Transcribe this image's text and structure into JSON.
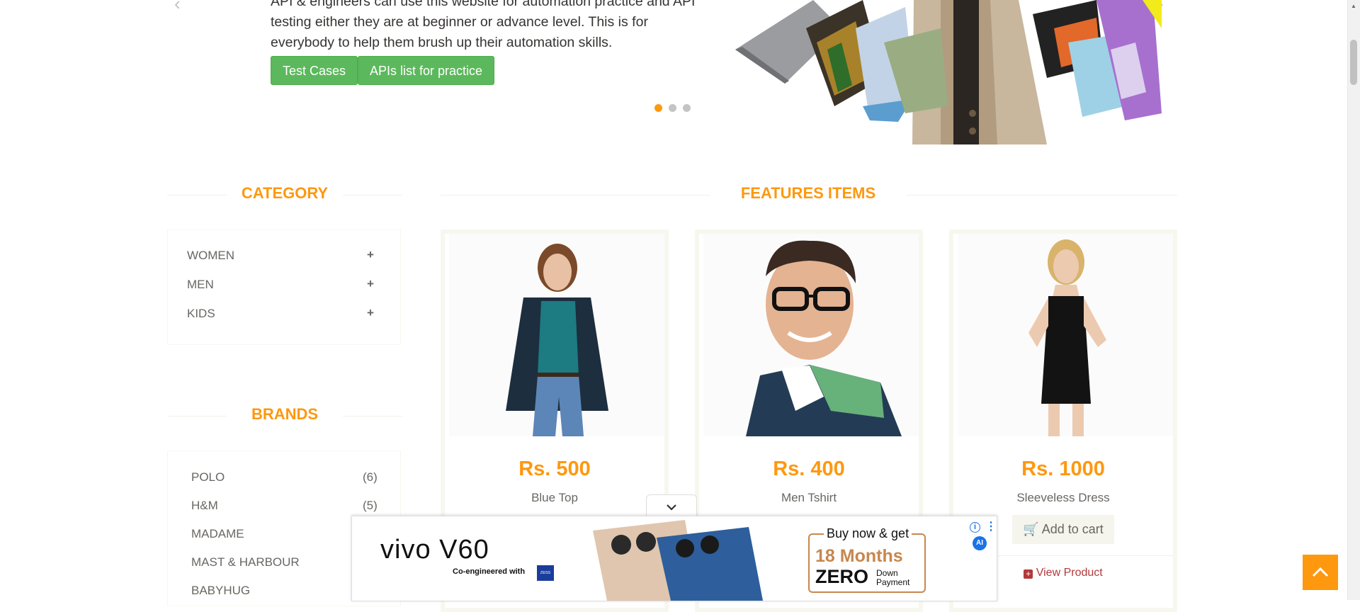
{
  "hero": {
    "text": "API & engineers can use this website for automation practice and API testing either they are at beginner or advance level. This is for everybody to help them brush up their automation skills.",
    "buttons": [
      "Test Cases",
      "APIs list for practice"
    ],
    "slides": 3,
    "active_slide": 1
  },
  "sidebar": {
    "category_title": "CATEGORY",
    "categories": [
      "WOMEN",
      "MEN",
      "KIDS"
    ],
    "brands_title": "BRANDS",
    "brands": [
      {
        "name": "POLO",
        "count": "(6)"
      },
      {
        "name": "H&M",
        "count": "(5)"
      },
      {
        "name": "MADAME",
        "count": ""
      },
      {
        "name": "MAST & HARBOUR",
        "count": ""
      },
      {
        "name": "BABYHUG",
        "count": ""
      }
    ]
  },
  "features": {
    "title": "FEATURES ITEMS",
    "products": [
      {
        "price": "Rs. 500",
        "name": "Blue Top"
      },
      {
        "price": "Rs. 400",
        "name": "Men Tshirt"
      },
      {
        "price": "Rs. 1000",
        "name": "Sleeveless Dress",
        "add_to_cart": "Add to cart",
        "view_product": "View Product"
      }
    ]
  },
  "ad": {
    "brand": "vivo V60",
    "tagline": "Co-engineered with",
    "partner": "ZEISS",
    "offer_line1": "Buy now & get",
    "offer_line2": "18 Months",
    "offer_line3": "ZERO",
    "offer_line4": "Down Payment",
    "badge": "AI"
  },
  "colors": {
    "accent": "#fe980f",
    "green": "#5cb85c",
    "link_red": "#b3393a"
  }
}
